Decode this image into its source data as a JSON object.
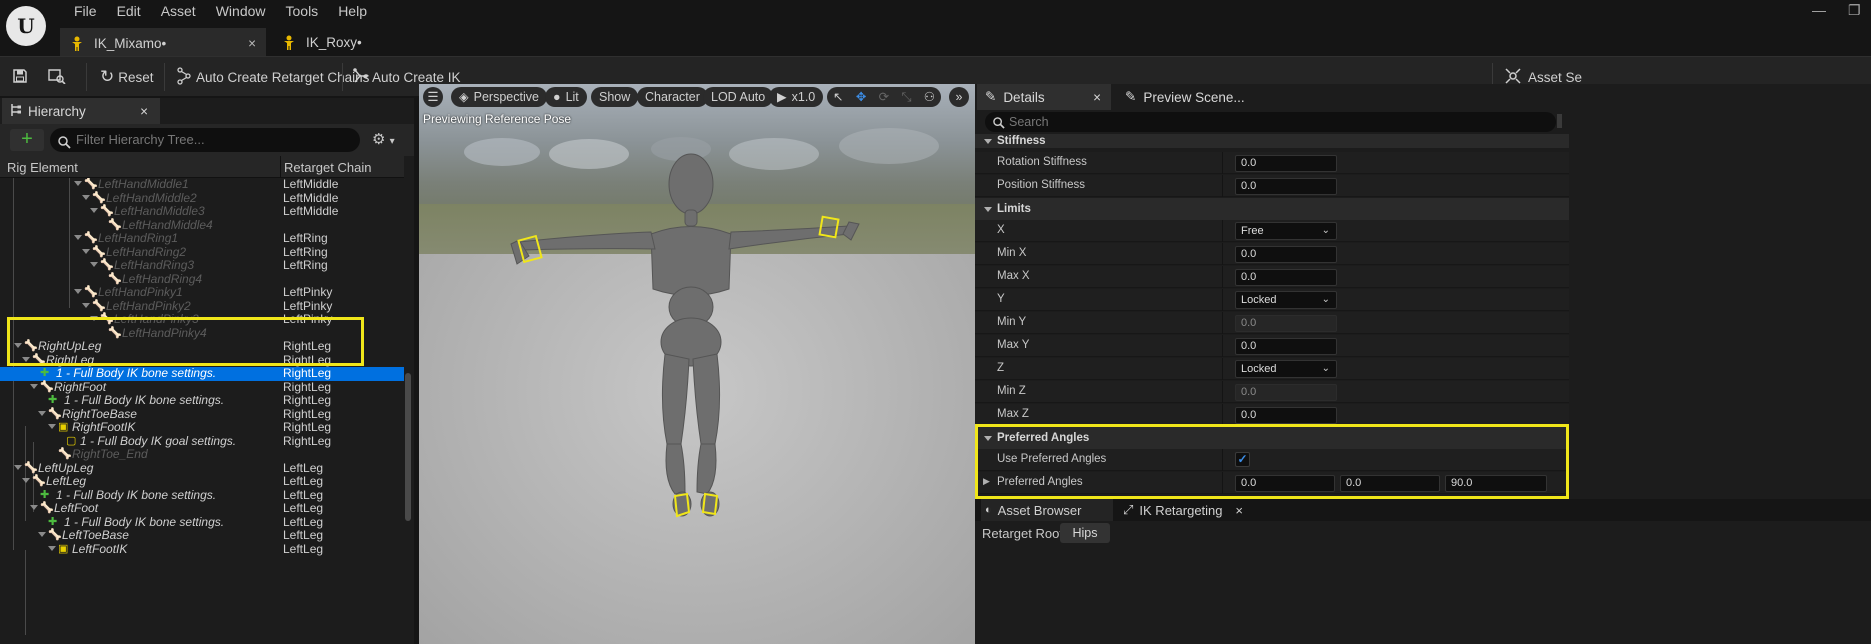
{
  "app": {
    "logo_text": "U",
    "menu": [
      "File",
      "Edit",
      "Asset",
      "Window",
      "Tools",
      "Help"
    ],
    "window_controls": {
      "minimize": "—",
      "restore": "❐"
    }
  },
  "doc_tabs": [
    {
      "label": "IK_Mixamo•",
      "close": "×"
    },
    {
      "label": "IK_Roxy•"
    }
  ],
  "toolbar": {
    "reset": "Reset",
    "auto_chains": "Auto Create Retarget Chains",
    "auto_ik": "Auto Create IK",
    "asset_settings": "Asset Se"
  },
  "hierarchy": {
    "tab_label": "Hierarchy",
    "close": "×",
    "add": "+",
    "filter_placeholder": "Filter Hierarchy Tree...",
    "col_element": "Rig Element",
    "col_chain": "Retarget Chain",
    "rows": [
      {
        "name": "LeftHandMiddle1",
        "chain": "LeftMiddle"
      },
      {
        "name": "LeftHandMiddle2",
        "chain": "LeftMiddle"
      },
      {
        "name": "LeftHandMiddle3",
        "chain": "LeftMiddle"
      },
      {
        "name": "LeftHandMiddle4",
        "chain": ""
      },
      {
        "name": "LeftHandRing1",
        "chain": "LeftRing"
      },
      {
        "name": "LeftHandRing2",
        "chain": "LeftRing"
      },
      {
        "name": "LeftHandRing3",
        "chain": "LeftRing"
      },
      {
        "name": "LeftHandRing4",
        "chain": ""
      },
      {
        "name": "LeftHandPinky1",
        "chain": "LeftPinky"
      },
      {
        "name": "LeftHandPinky2",
        "chain": "LeftPinky"
      },
      {
        "name": "LeftHandPinky3",
        "chain": "LeftPinky"
      },
      {
        "name": "LeftHandPinky4",
        "chain": ""
      },
      {
        "name": "RightUpLeg",
        "chain": "RightLeg"
      },
      {
        "name": "RightLeg",
        "chain": "RightLeg"
      },
      {
        "name": "1 - Full Body IK bone settings.",
        "chain": "RightLeg"
      },
      {
        "name": "RightFoot",
        "chain": "RightLeg"
      },
      {
        "name": "1 - Full Body IK bone settings.",
        "chain": "RightLeg"
      },
      {
        "name": "RightToeBase",
        "chain": "RightLeg"
      },
      {
        "name": "RightFootIK",
        "chain": "RightLeg"
      },
      {
        "name": "1 - Full Body IK goal settings.",
        "chain": "RightLeg"
      },
      {
        "name": "RightToe_End",
        "chain": ""
      },
      {
        "name": "LeftUpLeg",
        "chain": "LeftLeg"
      },
      {
        "name": "LeftLeg",
        "chain": "LeftLeg"
      },
      {
        "name": "1 - Full Body IK bone settings.",
        "chain": "LeftLeg"
      },
      {
        "name": "LeftFoot",
        "chain": "LeftLeg"
      },
      {
        "name": "1 - Full Body IK bone settings.",
        "chain": "LeftLeg"
      },
      {
        "name": "LeftToeBase",
        "chain": "LeftLeg"
      },
      {
        "name": "LeftFootIK",
        "chain": "LeftLeg"
      }
    ]
  },
  "viewport": {
    "perspective": "Perspective",
    "lit": "Lit",
    "show": "Show",
    "character": "Character",
    "lod": "LOD Auto",
    "speed": "x1.0",
    "label": "Previewing Reference Pose"
  },
  "details": {
    "tab_details": "Details",
    "tab_preview": "Preview Scene...",
    "close": "×",
    "search_placeholder": "Search",
    "sections": {
      "stiffness": "Stiffness",
      "limits": "Limits",
      "preferred": "Preferred Angles"
    },
    "props": {
      "rotation_stiffness": {
        "label": "Rotation Stiffness",
        "value": "0.0"
      },
      "position_stiffness": {
        "label": "Position Stiffness",
        "value": "0.0"
      },
      "x": {
        "label": "X",
        "value": "Free"
      },
      "min_x": {
        "label": "Min X",
        "value": "0.0"
      },
      "max_x": {
        "label": "Max X",
        "value": "0.0"
      },
      "y": {
        "label": "Y",
        "value": "Locked"
      },
      "min_y": {
        "label": "Min Y",
        "value": "0.0"
      },
      "max_y": {
        "label": "Max Y",
        "value": "0.0"
      },
      "z": {
        "label": "Z",
        "value": "Locked"
      },
      "min_z": {
        "label": "Min Z",
        "value": "0.0"
      },
      "max_z": {
        "label": "Max Z",
        "value": "0.0"
      },
      "use_preferred": {
        "label": "Use Preferred Angles",
        "checked": true
      },
      "preferred_angles": {
        "label": "Preferred Angles",
        "x": "0.0",
        "y": "0.0",
        "z": "90.0"
      }
    },
    "bottom_tabs": {
      "asset_browser": "Asset Browser",
      "ik_retargeting": "IK Retargeting",
      "close": "×"
    },
    "retarget_root_label": "Retarget Root:",
    "retarget_root_value": "Hips"
  },
  "colors": {
    "selection": "#0070e0",
    "highlight": "#f0e61a",
    "bone_icon": "#e8e8e8",
    "ik_goal": "#e8d000",
    "ik_settings": "#4dbb3f"
  }
}
